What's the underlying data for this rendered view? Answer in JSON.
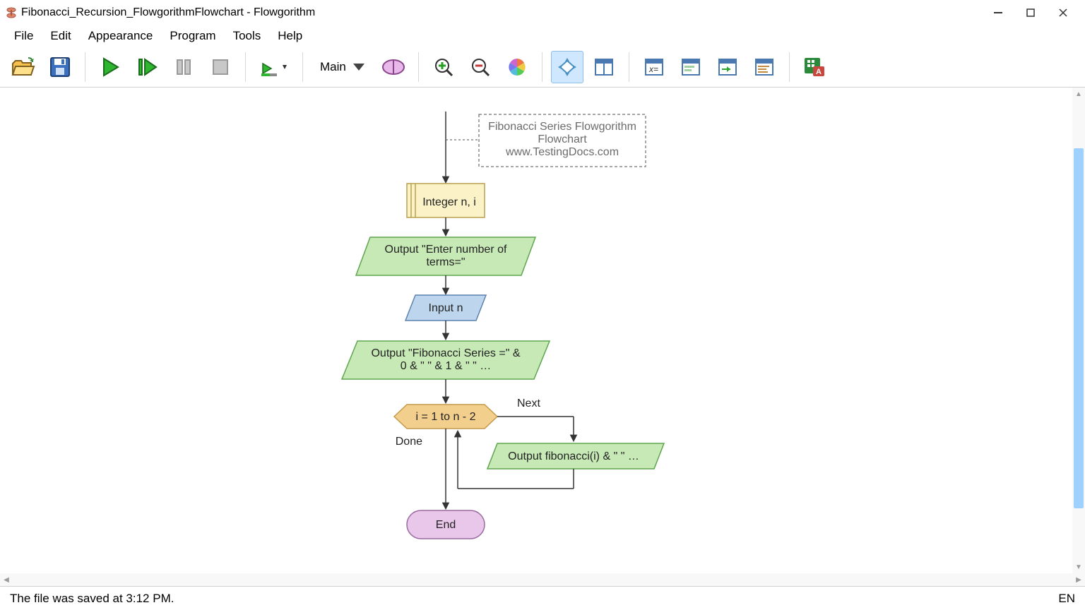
{
  "window": {
    "title": "Fibonacci_Recursion_FlowgorithmFlowchart - Flowgorithm"
  },
  "menu": {
    "file": "File",
    "edit": "Edit",
    "appearance": "Appearance",
    "program": "Program",
    "tools": "Tools",
    "help": "Help"
  },
  "toolbar": {
    "function_selected": "Main"
  },
  "flowchart": {
    "comment_line1": "Fibonacci Series Flowgorithm",
    "comment_line2": "Flowchart",
    "comment_line3": "www.TestingDocs.com",
    "declare": "Integer n, i",
    "output1_line1": "Output \"Enter number of",
    "output1_line2": "terms=\"",
    "input": "Input n",
    "output2_line1": "Output \"Fibonacci Series =\" &",
    "output2_line2": "0 & \" \" & 1 & \" \" …",
    "for": "i = 1 to n - 2",
    "for_next": "Next",
    "for_done": "Done",
    "output3": "Output fibonacci(i) & \" \" …",
    "end": "End"
  },
  "status": {
    "message": "The file was saved at 3:12 PM.",
    "language": "EN"
  }
}
